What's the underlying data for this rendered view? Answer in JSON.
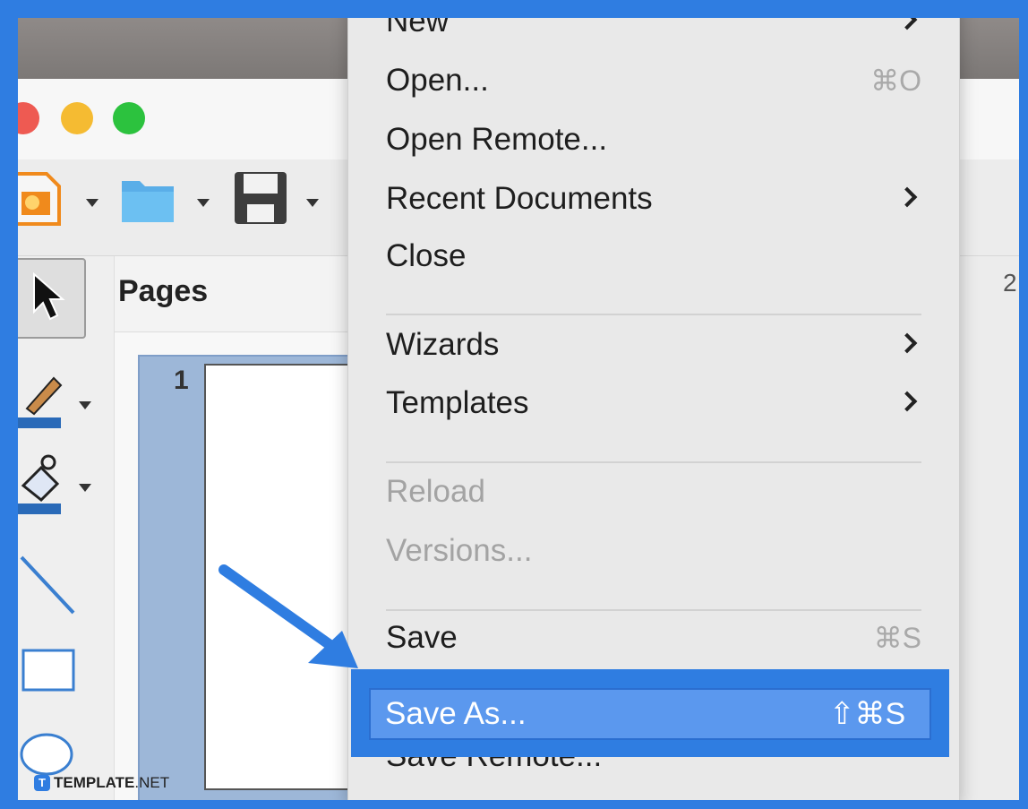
{
  "panel": {
    "title": "Pages",
    "page_number": "1"
  },
  "ruler": {
    "visible_number": "2"
  },
  "menu": {
    "items": [
      {
        "label": "New",
        "submenu": true
      },
      {
        "label": "Open...",
        "shortcut": "⌘O"
      },
      {
        "label": "Open Remote..."
      },
      {
        "label": "Recent Documents",
        "submenu": true
      },
      {
        "label": "Close"
      },
      {
        "label": "Wizards",
        "submenu": true
      },
      {
        "label": "Templates",
        "submenu": true
      },
      {
        "label": "Reload",
        "disabled": true
      },
      {
        "label": "Versions...",
        "disabled": true
      },
      {
        "label": "Save",
        "shortcut": "⌘S"
      },
      {
        "label": "Save As...",
        "shortcut": "⇧⌘S",
        "highlighted": true
      },
      {
        "label": "Save Remote..."
      }
    ]
  },
  "watermark": {
    "brand": "TEMPLATE",
    "suffix": ".NET",
    "logo_letter": "T"
  },
  "colors": {
    "accent": "#2f7de1",
    "highlight": "#5b98ee"
  },
  "icons": [
    "impress-icon",
    "folder-icon",
    "save-disk-icon",
    "pointer-arrow-icon",
    "fill-color-icon",
    "line-color-icon",
    "line-tool-icon",
    "rectangle-tool-icon",
    "ellipse-tool-icon"
  ]
}
